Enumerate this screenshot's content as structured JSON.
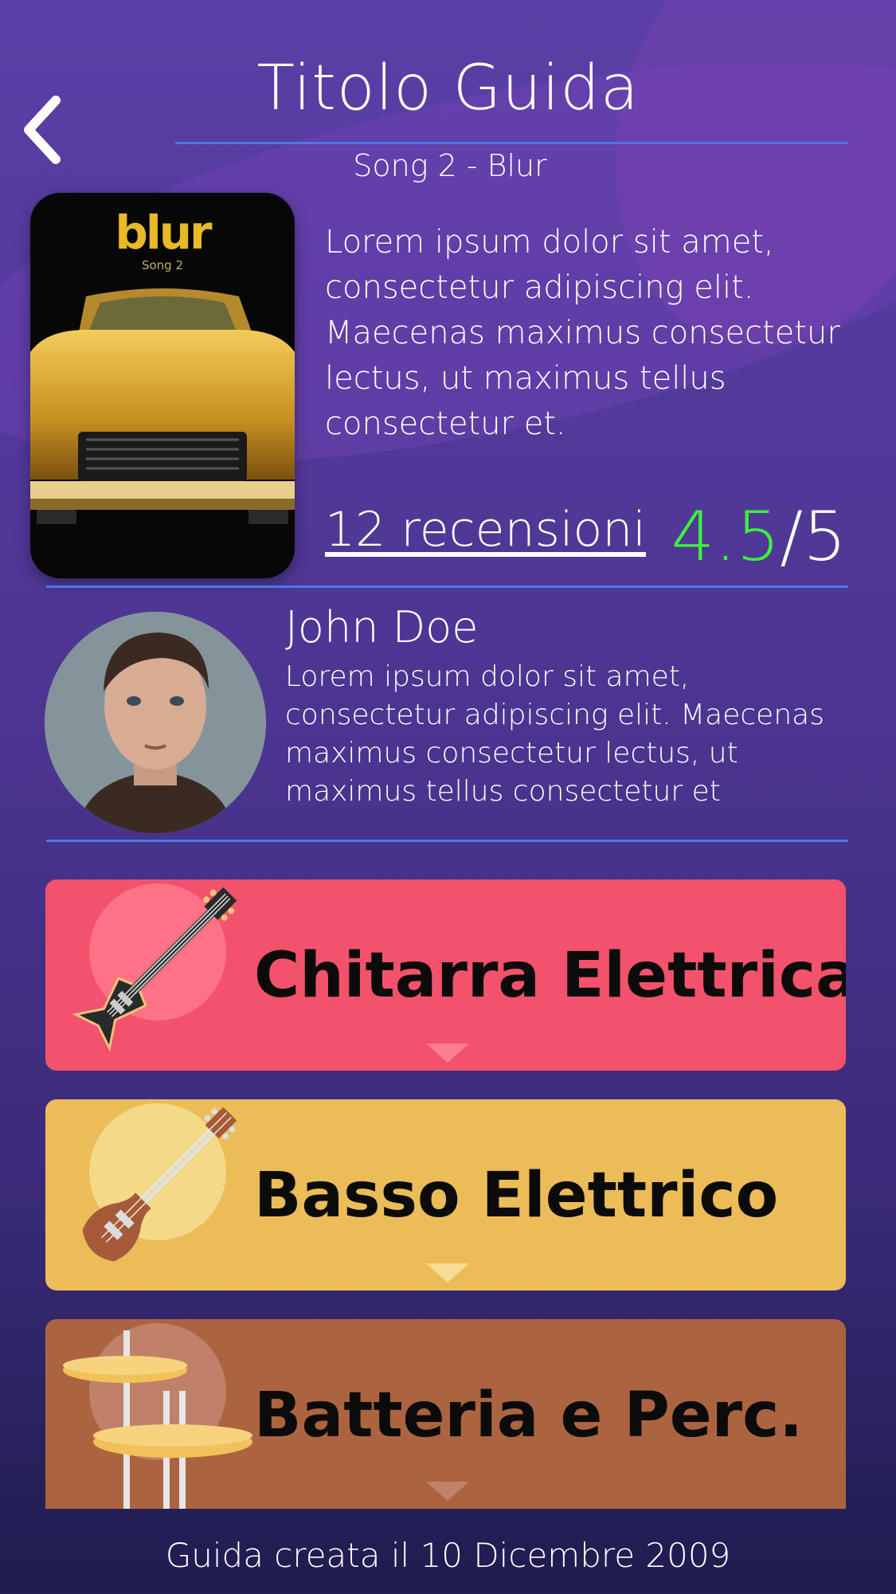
{
  "header": {
    "title": "Titolo Guida",
    "subtitle": "Song 2 - Blur"
  },
  "song": {
    "cover_brand": "blur",
    "cover_song": "Song 2",
    "description": "Lorem ipsum dolor sit amet, consectetur adipiscing elit. Maecenas maximus consectetur lectus, ut maximus tellus consectetur et.",
    "reviews_label": "12 recensioni",
    "rating_score": "4.5",
    "rating_max": "/5"
  },
  "author": {
    "name": "John Doe",
    "bio": "Lorem ipsum dolor sit amet, consectetur adipiscing elit. Maecenas maximus consectetur lectus, ut maximus tellus consectetur et"
  },
  "instruments": [
    {
      "label": "Chitarra Elettrica",
      "icon": "electric-guitar-icon",
      "color": "#f2526b",
      "circle": "#fe7286",
      "chevron": "#fe7f8f"
    },
    {
      "label": "Basso Elettrico",
      "icon": "bass-guitar-icon",
      "color": "#ecbc58",
      "circle": "#f4d988",
      "chevron": "#f6dd95"
    },
    {
      "label": "Batteria e Perc.",
      "icon": "cymbals-icon",
      "color": "#ac6440",
      "circle": "#c08168",
      "chevron": "#c0826a"
    }
  ],
  "footer": {
    "text": "Guida creata il 10 Dicembre 2009"
  },
  "colors": {
    "accent_line": "#4b78e6",
    "rating_green": "#3df23a"
  }
}
